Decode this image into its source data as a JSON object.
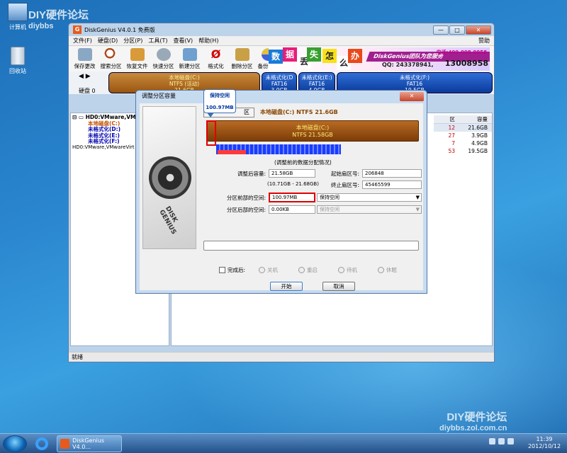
{
  "desktop": {
    "icons": [
      {
        "label": "计算机"
      },
      {
        "label": "回收站"
      }
    ],
    "watermark_top": {
      "title": "DIY硬件论坛",
      "url": "diybbs"
    },
    "watermark_bottom": {
      "title": "DIY硬件论坛",
      "url": "diybbs.zol.com.cn"
    }
  },
  "window": {
    "title": "DiskGenius V4.0.1 免费版",
    "controls": {
      "min": "—",
      "max": "□",
      "close": "✕"
    },
    "menu": [
      "文件(F)",
      "硬盘(D)",
      "分区(P)",
      "工具(T)",
      "查看(V)",
      "帮助(H)"
    ],
    "help_label": "赞助",
    "toolbar": [
      "保存更改",
      "搜索分区",
      "恢复文件",
      "快速分区",
      "新建分区",
      "格式化",
      "删除分区",
      "备份分区"
    ],
    "banner": {
      "tiles": [
        "数",
        "据",
        "丢",
        "失",
        "怎",
        "么",
        "办"
      ],
      "stripe": "DiskGenius团队为您服务",
      "phone": "电话:400-008-9958",
      "qq": "QQ: 243378941,",
      "phone2": "13008958"
    },
    "disk_label": "硬盘 0",
    "partitions": [
      {
        "name": "本地磁盘(C:)",
        "fs": "NTFS (活动)",
        "size": "21.6GB"
      },
      {
        "name": "未格式化(D",
        "fs": "FAT16",
        "size": "3.9GB"
      },
      {
        "name": "未格式化(E:)",
        "fs": "FAT16",
        "size": "4.9GB"
      },
      {
        "name": "未格式化(F:)",
        "fs": "FAT16",
        "size": "19.5GB"
      }
    ],
    "tree": {
      "root": "HD0:VMware,VMw",
      "items": [
        "本地磁盘(C:)",
        "未格式化(D:)",
        "未格式化(E:)",
        "未格式化(F:)"
      ],
      "model": "HD0:VMware,VMwareVirt"
    },
    "table": {
      "headers": [
        "区",
        "容量"
      ],
      "rows": [
        [
          "12",
          "21.6GB"
        ],
        [
          "27",
          "3.9GB"
        ],
        [
          "7",
          "4.9GB"
        ],
        [
          "53",
          "19.5GB"
        ]
      ]
    },
    "status": "就绪"
  },
  "dialog": {
    "title": "调整分区容量",
    "close": "✕",
    "partition_button": "区",
    "header": "本地磁盘(C:) NTFS 21.6GB",
    "bar_name": "本地磁盘(C:)",
    "bar_fs": "NTFS 21.58GB",
    "usage_caption": "(调整前的数据分配情况)",
    "fields": {
      "size_label": "调整后容量:",
      "size_value": "21.58GB",
      "size_range": "(10.71GB - 21.68GB)",
      "start_label": "起始扇区号:",
      "start_value": "206848",
      "end_label": "终止扇区号:",
      "end_value": "45465599",
      "front_label": "分区前部的空间:",
      "front_value": "100.97MB",
      "front_action": "保持空闲",
      "back_label": "分区后部的空间:",
      "back_value": "0.00KB",
      "back_action": "保持空闲"
    },
    "after_label": "完成后:",
    "after_options": [
      "关机",
      "重启",
      "待机",
      "休眠"
    ],
    "start_button": "开始",
    "cancel_button": "取消",
    "tooltip": {
      "title": "保持空闲",
      "value": "100.97MB"
    },
    "progress": 0
  },
  "taskbar": {
    "app": "DiskGenius V4.0...",
    "clock_time": "11:39",
    "clock_date": "2012/10/12"
  }
}
